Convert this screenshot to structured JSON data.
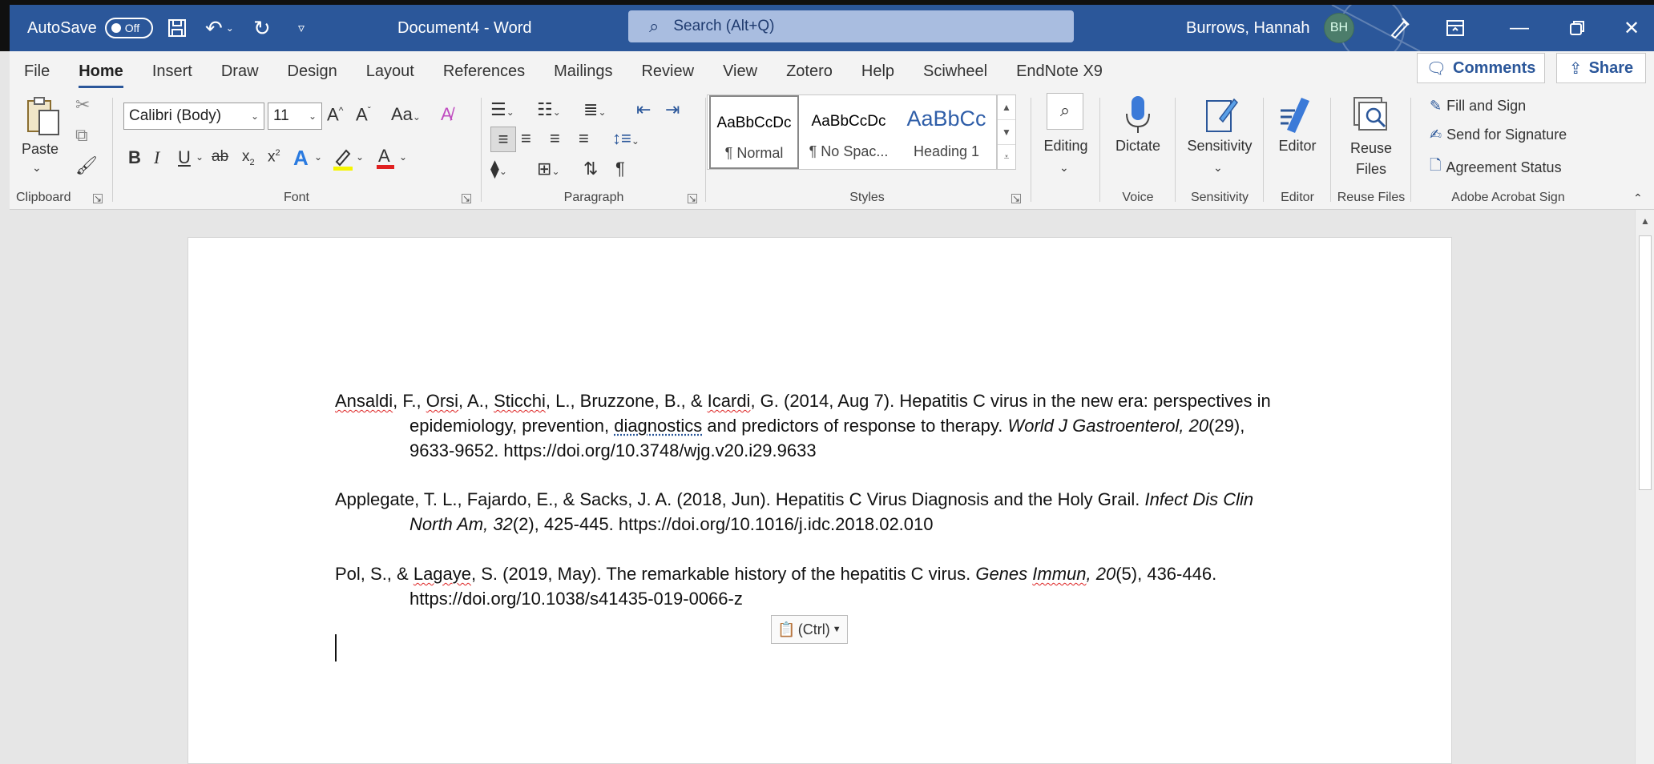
{
  "titlebar": {
    "autosave_label": "AutoSave",
    "autosave_state": "Off",
    "doc_title": "Document4 - Word",
    "search_placeholder": "Search (Alt+Q)",
    "user_name": "Burrows, Hannah",
    "user_initials": "BH"
  },
  "tabs": [
    "File",
    "Home",
    "Insert",
    "Draw",
    "Design",
    "Layout",
    "References",
    "Mailings",
    "Review",
    "View",
    "Zotero",
    "Help",
    "Sciwheel",
    "EndNote X9"
  ],
  "top_buttons": {
    "comments": "Comments",
    "share": "Share"
  },
  "ribbon": {
    "clipboard": {
      "paste": "Paste",
      "label": "Clipboard"
    },
    "font": {
      "name": "Calibri (Body)",
      "size": "11",
      "label": "Font",
      "change_case": "Aa"
    },
    "paragraph": {
      "label": "Paragraph"
    },
    "styles": {
      "label": "Styles",
      "items": [
        {
          "sample": "AaBbCcDc",
          "name": "¶ Normal"
        },
        {
          "sample": "AaBbCcDc",
          "name": "¶ No Spac..."
        },
        {
          "sample": "AaBbCc",
          "name": "Heading 1"
        }
      ]
    },
    "editing": {
      "label": "Editing"
    },
    "voice": {
      "dictate": "Dictate",
      "label": "Voice"
    },
    "sensitivity": {
      "button": "Sensitivity",
      "label": "Sensitivity"
    },
    "editor": {
      "button": "Editor",
      "label": "Editor"
    },
    "reuse": {
      "button_line1": "Reuse",
      "button_line2": "Files",
      "label": "Reuse Files"
    },
    "acrobat": {
      "label": "Adobe Acrobat Sign",
      "fill_sign": "Fill and Sign",
      "send_signature": "Send for Signature",
      "agreement_status": "Agreement Status"
    }
  },
  "document": {
    "refs": [
      {
        "a1": "Ansaldi",
        "a2": ", F., ",
        "a3": "Orsi",
        "a4": ", A., ",
        "a5": "Sticchi",
        "a6": ", L., Bruzzone, B., & ",
        "a7": "Icardi",
        "a8": ", G. (2014, Aug 7). Hepatitis C virus in the new era: perspectives in",
        "b1": "epidemiology, prevention, ",
        "b2": "diagnostics",
        "b3": " and predictors of response to therapy. ",
        "b4": "World J Gastroenterol, 20",
        "b5": "(29),",
        "c1": "9633-9652. https://doi.org/10.3748/wjg.v20.i29.9633"
      },
      {
        "a1": "Applegate, T. L., Fajardo, E., & Sacks, J. A. (2018, Jun). Hepatitis C Virus Diagnosis and the Holy Grail. ",
        "a2": "Infect Dis Clin",
        "b1": "North Am, 32",
        "b2": "(2), 425-445. https://doi.org/10.1016/j.idc.2018.02.010"
      },
      {
        "a1": "Pol, S., & ",
        "a2": "Lagaye",
        "a3": ", S. (2019, May). The remarkable history of the hepatitis C virus. ",
        "a4": "Genes ",
        "a5": "Immun",
        "a6": ", 20",
        "a7": "(5), 436-446.",
        "b1": "https://doi.org/10.1038/s41435-019-0066-z"
      }
    ],
    "paste_options": "(Ctrl)"
  }
}
